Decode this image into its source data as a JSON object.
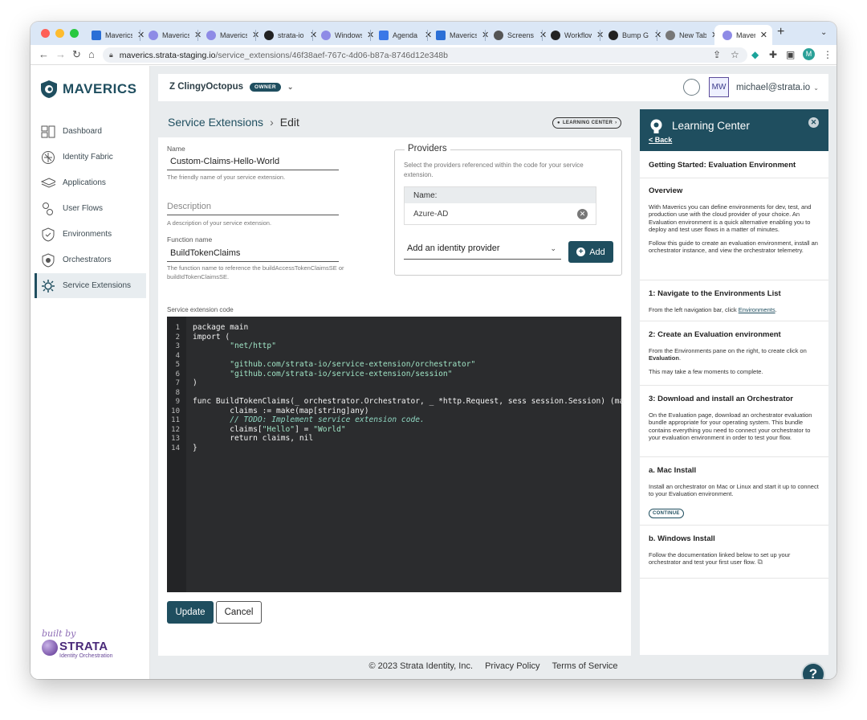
{
  "browser": {
    "tabs": [
      {
        "title": "Maverics",
        "active": false,
        "favicon": "maverics-favicon"
      },
      {
        "title": "Maverics",
        "active": false,
        "favicon": "maverics-favicon"
      },
      {
        "title": "Maverics",
        "active": false,
        "favicon": "maverics-favicon"
      },
      {
        "title": "strata-io",
        "active": false,
        "favicon": "github-favicon"
      },
      {
        "title": "Windows",
        "active": false,
        "favicon": "maverics-favicon"
      },
      {
        "title": "Agenda",
        "active": false,
        "favicon": "docs-favicon"
      },
      {
        "title": "Maverics",
        "active": false,
        "favicon": "maverics-favicon"
      },
      {
        "title": "Screens",
        "active": false,
        "favicon": "screen-favicon"
      },
      {
        "title": "Workflow",
        "active": false,
        "favicon": "github-favicon"
      },
      {
        "title": "Bump G",
        "active": false,
        "favicon": "github-favicon"
      },
      {
        "title": "New Tab",
        "active": false,
        "favicon": "chrome-favicon"
      },
      {
        "title": "Maverics",
        "active": true,
        "favicon": "maverics-favicon"
      }
    ],
    "url_host": "maverics.strata-staging.io",
    "url_path": "/service_extensions/46f38aef-767c-4d06-b87a-8746d12e348b",
    "profile_initial": "M"
  },
  "sidebar": {
    "brand": "MAVERICS",
    "items": [
      {
        "label": "Dashboard",
        "icon": "dashboard-icon",
        "active": false
      },
      {
        "label": "Identity Fabric",
        "icon": "identity-fabric-icon",
        "active": false
      },
      {
        "label": "Applications",
        "icon": "applications-icon",
        "active": false
      },
      {
        "label": "User Flows",
        "icon": "user-flows-icon",
        "active": false
      },
      {
        "label": "Environments",
        "icon": "environments-icon",
        "active": false
      },
      {
        "label": "Orchestrators",
        "icon": "orchestrators-icon",
        "active": false
      },
      {
        "label": "Service Extensions",
        "icon": "service-extensions-icon",
        "active": true
      }
    ],
    "strata": {
      "built_by": "built by",
      "name": "STRATA",
      "tagline": "Identity Orchestration"
    }
  },
  "header": {
    "tenant": "Z ClingyOctopus",
    "role_badge": "OWNER",
    "user_initials": "MW",
    "user_email": "michael@strata.io"
  },
  "main": {
    "breadcrumb_parent": "Service Extensions",
    "breadcrumb_current": "Edit",
    "learning_center_button": "LEARNING CENTER",
    "name": {
      "label": "Name",
      "value": "Custom-Claims-Hello-World",
      "help": "The friendly name of your service extension."
    },
    "description": {
      "placeholder": "Description",
      "help": "A description of your service extension."
    },
    "function_name": {
      "label": "Function name",
      "value": "BuildTokenClaims",
      "help": "The function name to reference the buildAccessTokenClaimsSE or buildIdTokenClaimsSE."
    },
    "providers": {
      "title": "Providers",
      "help": "Select the providers referenced within the code for your service extension.",
      "table_header": "Name:",
      "rows": [
        "Azure-AD"
      ],
      "select_value": "Add an identity provider",
      "add_label": "Add"
    },
    "code_label": "Service extension code",
    "code_lines": [
      "1",
      "2",
      "3",
      "4",
      "5",
      "6",
      "7",
      "8",
      "9",
      "10",
      "11",
      "12",
      "13",
      "14"
    ],
    "code": {
      "l1": "package main",
      "l2": "import (",
      "l3": "        \"net/http\"",
      "l5": "        \"github.com/strata-io/service-extension/orchestrator\"",
      "l6": "        \"github.com/strata-io/service-extension/session\"",
      "l7": ")",
      "l9": "func BuildTokenClaims(_ orchestrator.Orchestrator, _ *http.Request, sess session.Session) (ma",
      "l10": "        claims := make(map[string]any)",
      "l11": "        // TODO: Implement service extension code.",
      "l12a": "        claims[",
      "l12b": "\"Hello\"",
      "l12c": "] = ",
      "l12d": "\"World\"",
      "l13": "        return claims, nil",
      "l14": "}"
    },
    "update_label": "Update",
    "cancel_label": "Cancel"
  },
  "learning_center": {
    "title": "Learning Center",
    "back": "< Back",
    "guide_title": "Getting Started: Evaluation Environment",
    "overview": {
      "heading": "Overview",
      "p1": "With Maverics you can define environments for dev, test, and production use with the cloud provider of your choice. An Evaluation environment is a quick alternative enabling you to deploy and test user flows in a matter of minutes.",
      "p2": "Follow this guide to create an evaluation environment, install an orchestrator instance, and view the orchestrator telemetry."
    },
    "step1": {
      "heading": "1: Navigate to the Environments List",
      "text": "From the left navigation bar, click ",
      "link": "Environments",
      "end": "."
    },
    "step2": {
      "heading": "2: Create an Evaluation environment",
      "text": "From the Environments pane on the right, to create click on ",
      "bold": "Evaluation",
      "end": ".",
      "p2": "This may take a few moments to complete."
    },
    "step3": {
      "heading": "3: Download and install an Orchestrator",
      "text": "On the Evaluation page, download an orchestrator evaluation bundle appropriate for your operating system. This bundle contains everything you need to connect your orchestrator to your evaluation environment in order to test your flow."
    },
    "mac": {
      "heading": "a. Mac Install",
      "text": "Install an orchestrator on Mac or Linux and start it up to connect to your Evaluation environment.",
      "button": "CONTINUE"
    },
    "windows": {
      "heading": "b. Windows Install",
      "text": "Follow the documentation linked below to set up your orchestrator and test your first user flow."
    }
  },
  "footer": {
    "copyright": "© 2023 Strata Identity, Inc.",
    "privacy": "Privacy Policy",
    "terms": "Terms of Service"
  },
  "colors": {
    "brand": "#1f4e5f",
    "tabstrip": "#dbe7f6",
    "editor_bg": "#2b2c2e"
  }
}
